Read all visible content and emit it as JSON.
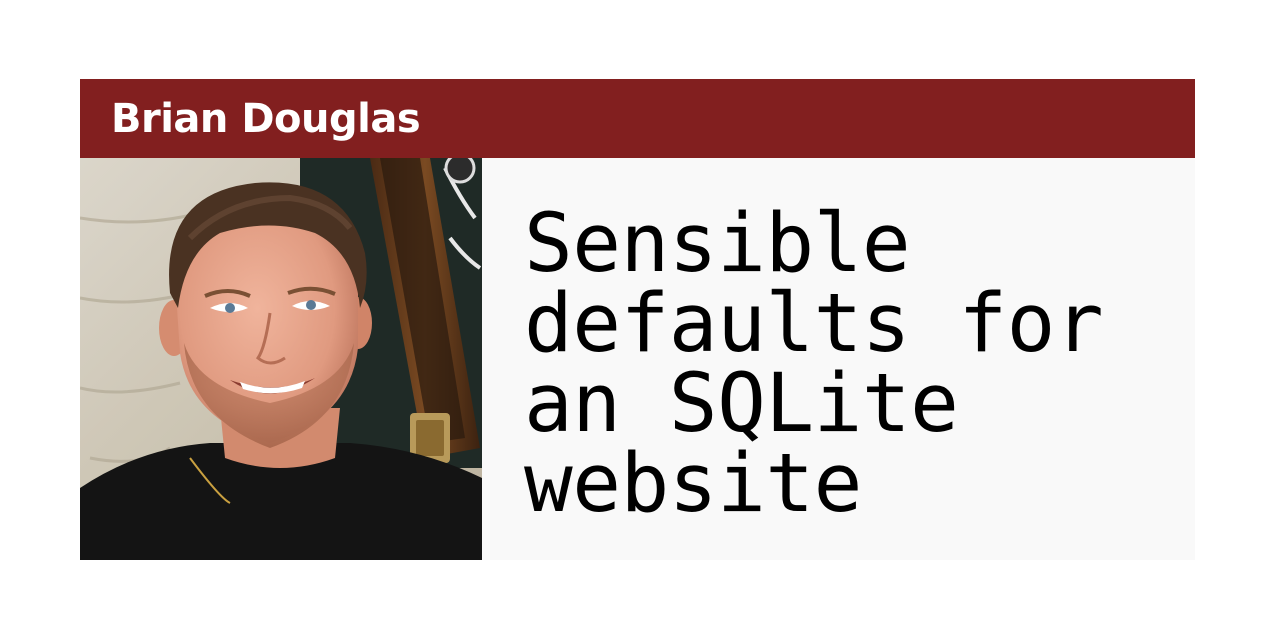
{
  "author": {
    "name": "Brian Douglas"
  },
  "post": {
    "title": "Sensible\ndefaults for\nan SQLite\nwebsite"
  },
  "colors": {
    "header_background": "#821f1f",
    "header_text": "#ffffff",
    "panel_background": "#f9f9f9",
    "title_text": "#000000"
  }
}
